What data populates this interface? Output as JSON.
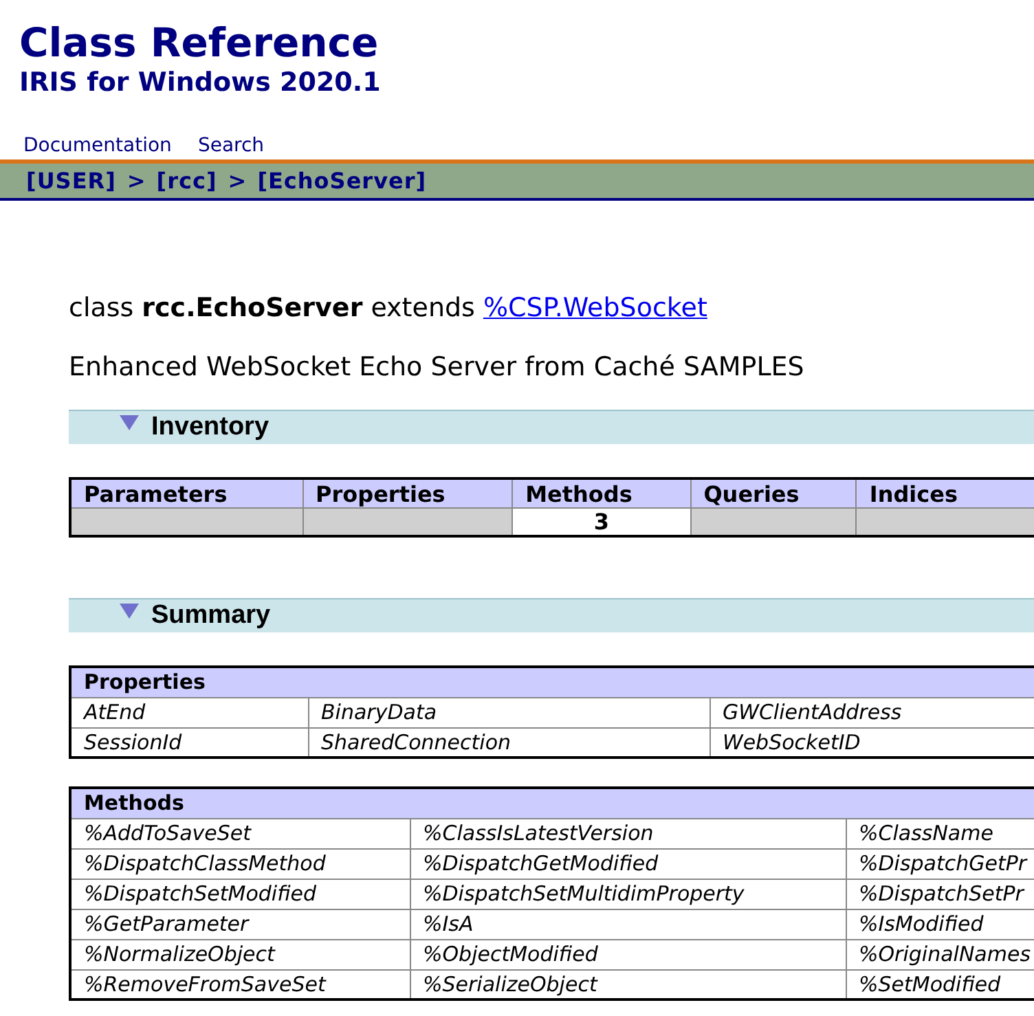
{
  "header": {
    "title": "Class Reference",
    "subtitle": "IRIS for Windows 2020.1"
  },
  "nav_links": [
    "Documentation",
    "Search"
  ],
  "breadcrumb": [
    "[USER]",
    ">",
    "[rcc]",
    ">",
    "[EchoServer]"
  ],
  "class_line": {
    "prefix": "class",
    "name": "rcc.EchoServer",
    "extends_word": "extends",
    "superclass": "%CSP.WebSocket"
  },
  "description": "Enhanced WebSocket Echo Server from Caché SAMPLES",
  "inventory": {
    "heading": "Inventory",
    "expanded": true,
    "columns": [
      {
        "label": "Parameters"
      },
      {
        "label": "Properties"
      },
      {
        "label": "Methods",
        "count": "3"
      },
      {
        "label": "Queries"
      },
      {
        "label": "Indices"
      }
    ]
  },
  "summary": {
    "heading": "Summary",
    "expanded": true,
    "properties": {
      "heading": "Properties",
      "rows": [
        [
          "AtEnd",
          "BinaryData",
          "GWClientAddress"
        ],
        [
          "SessionId",
          "SharedConnection",
          "WebSocketID"
        ]
      ]
    },
    "methods": {
      "heading": "Methods",
      "rows": [
        [
          "%AddToSaveSet",
          "%ClassIsLatestVersion",
          "%ClassName"
        ],
        [
          "%DispatchClassMethod",
          "%DispatchGetModified",
          "%DispatchGetPr"
        ],
        [
          "%DispatchSetModified",
          "%DispatchSetMultidimProperty",
          "%DispatchSetPr"
        ],
        [
          "%GetParameter",
          "%IsA",
          "%IsModified"
        ],
        [
          "%NormalizeObject",
          "%ObjectModified",
          "%OriginalNames"
        ],
        [
          "%RemoveFromSaveSet",
          "%SerializeObject",
          "%SetModified"
        ]
      ]
    }
  }
}
